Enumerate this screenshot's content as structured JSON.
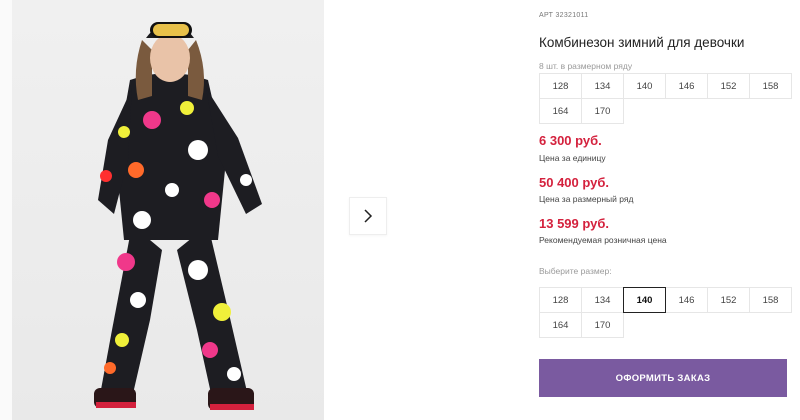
{
  "product": {
    "art_prefix": "АРТ",
    "art_number": "32321011",
    "title": "Комбинезон зимний для девочки",
    "row_note": "8 шт. в размерном ряду"
  },
  "sizes_row": [
    "128",
    "134",
    "140",
    "146",
    "152",
    "158",
    "164",
    "170"
  ],
  "prices": {
    "unit_price": "6 300 руб.",
    "unit_label": "Цена за единицу",
    "row_price": "50 400 руб.",
    "row_label": "Цена за размерный ряд",
    "retail_price": "13 599 руб.",
    "retail_label": "Рекомендуемая розничная цена"
  },
  "size_select": {
    "label": "Выберите размер:",
    "options": [
      "128",
      "134",
      "140",
      "146",
      "152",
      "158",
      "164",
      "170"
    ],
    "selected": "140"
  },
  "order_button": "ОФОРМИТЬ ЗАКАЗ",
  "colors": {
    "price": "#d4213d",
    "button": "#7a5aa0"
  },
  "icons": {
    "next": "chevron-right-icon"
  }
}
